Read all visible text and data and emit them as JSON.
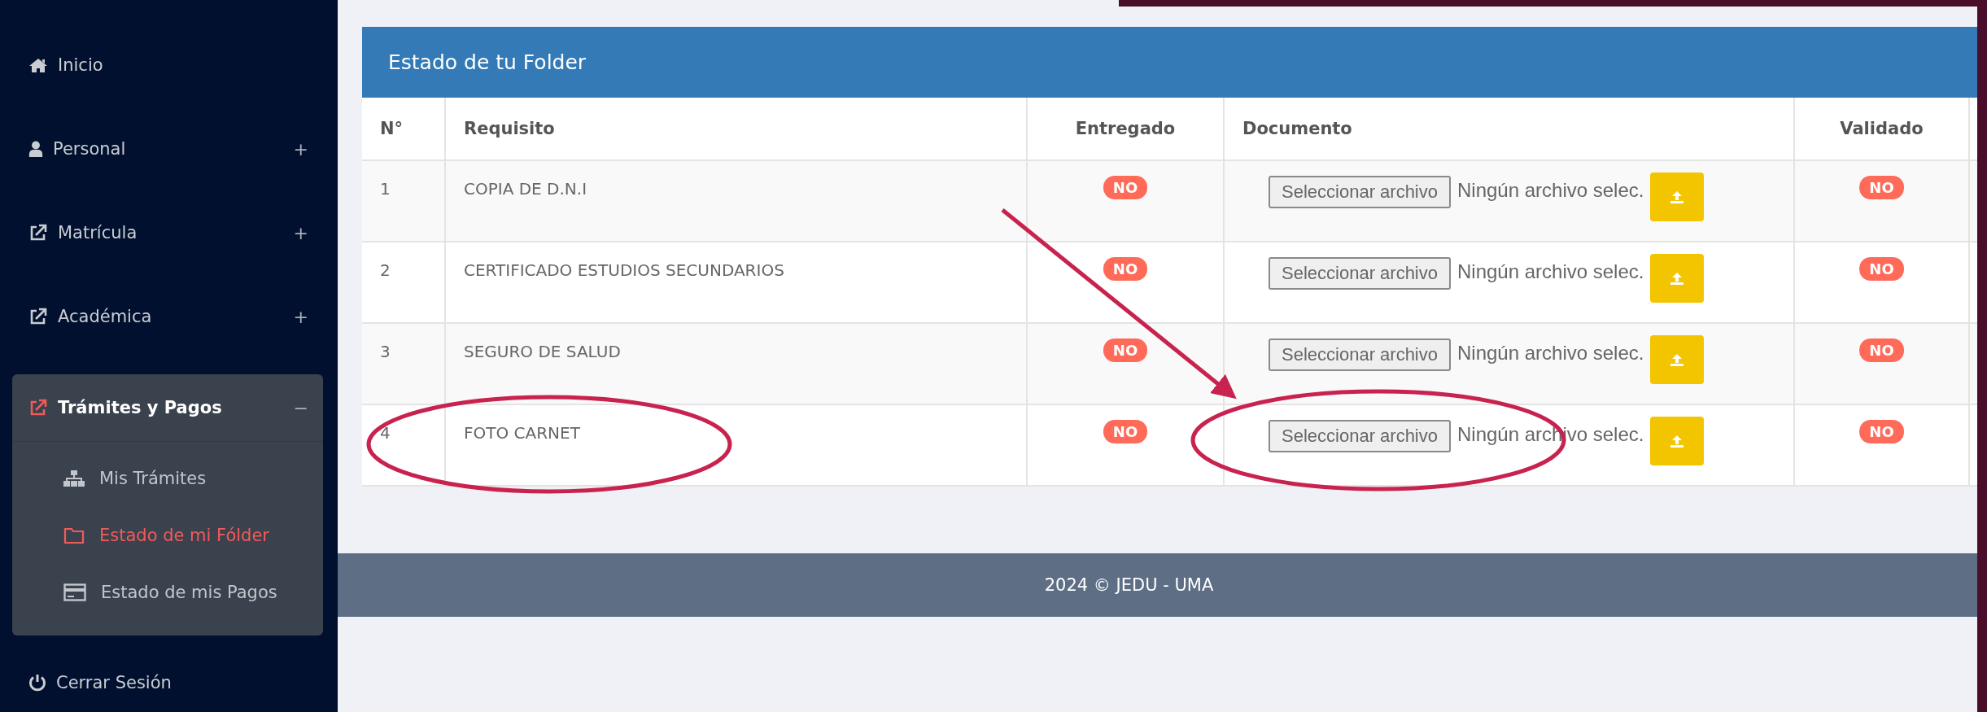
{
  "sidebar": {
    "items": [
      {
        "label": "Inicio",
        "expanded": false,
        "active": false
      },
      {
        "label": "Personal",
        "toggle": "+",
        "expanded": false,
        "active": false
      },
      {
        "label": "Matrícula",
        "toggle": "+",
        "expanded": false,
        "active": false
      },
      {
        "label": "Académica",
        "toggle": "+",
        "expanded": false,
        "active": false
      },
      {
        "label": "Trámites y Pagos",
        "toggle": "−",
        "expanded": true,
        "active": true,
        "children": [
          {
            "label": "Mis Trámites",
            "selected": false
          },
          {
            "label": "Estado de mi Fólder",
            "selected": true
          },
          {
            "label": "Estado de mis Pagos",
            "selected": false
          }
        ]
      },
      {
        "label": "Cerrar Sesión",
        "expanded": false,
        "active": false
      }
    ]
  },
  "panel": {
    "title": "Estado de tu Folder",
    "table": {
      "columns": [
        "N°",
        "Requisito",
        "Entregado",
        "Documento",
        "Validado"
      ],
      "rows": [
        {
          "n": "1",
          "requisito": "COPIA DE D.N.I",
          "entregado": "NO",
          "file_button": "Seleccionar archivo",
          "file_status": "Ningún archivo selec.",
          "validado": "NO"
        },
        {
          "n": "2",
          "requisito": "CERTIFICADO ESTUDIOS SECUNDARIOS",
          "entregado": "NO",
          "file_button": "Seleccionar archivo",
          "file_status": "Ningún archivo selec.",
          "validado": "NO"
        },
        {
          "n": "3",
          "requisito": "SEGURO DE SALUD",
          "entregado": "NO",
          "file_button": "Seleccionar archivo",
          "file_status": "Ningún archivo selec.",
          "validado": "NO"
        },
        {
          "n": "4",
          "requisito": "FOTO CARNET",
          "entregado": "NO",
          "file_button": "Seleccionar archivo",
          "file_status": "Ningún archivo selec.",
          "validado": "NO"
        }
      ]
    }
  },
  "footer": "2024 © JEDU - UMA",
  "annotations": [
    {
      "kind": "ellipse"
    },
    {
      "kind": "ellipse"
    },
    {
      "kind": "arrow"
    }
  ]
}
